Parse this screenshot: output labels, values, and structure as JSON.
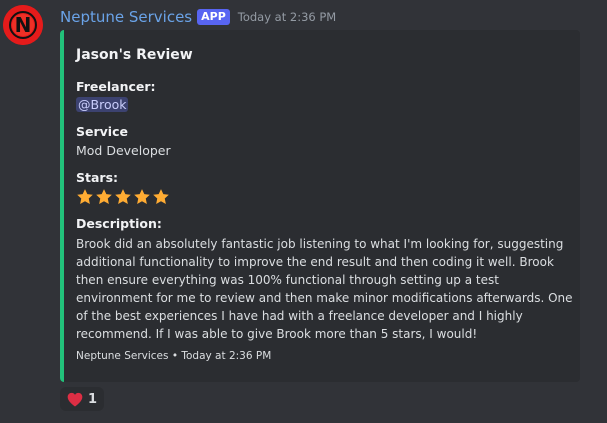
{
  "message": {
    "author": "Neptune Services",
    "app_tag": "APP",
    "timestamp": "Today at 2:36 PM",
    "avatar_icon": "neptune-logo-icon",
    "avatar_letter": "N"
  },
  "embed": {
    "accent_color": "#22c17a",
    "title": "Jason's Review",
    "fields": {
      "freelancer": {
        "name": "Freelancer:",
        "value": "@Brook"
      },
      "service": {
        "name": "Service",
        "value": "Mod Developer"
      },
      "stars": {
        "name": "Stars:",
        "rating": 5,
        "max": 5
      },
      "description": {
        "name": "Description:",
        "value": "Brook did an absolutely fantastic job listening to what I'm looking for, suggesting additional functionality to improve the end result and then coding it well. Brook then ensure everything was 100% functional through setting up a test environment for me to review and then make minor modifications afterwards. One of the best experiences I have had with a freelance developer and I highly recommend. If I was able to give Brook more than 5 stars, I would!"
      }
    },
    "footer": "Neptune Services • Today at 2:36 PM"
  },
  "reactions": [
    {
      "icon": "red-heart-icon",
      "count": "1"
    }
  ]
}
